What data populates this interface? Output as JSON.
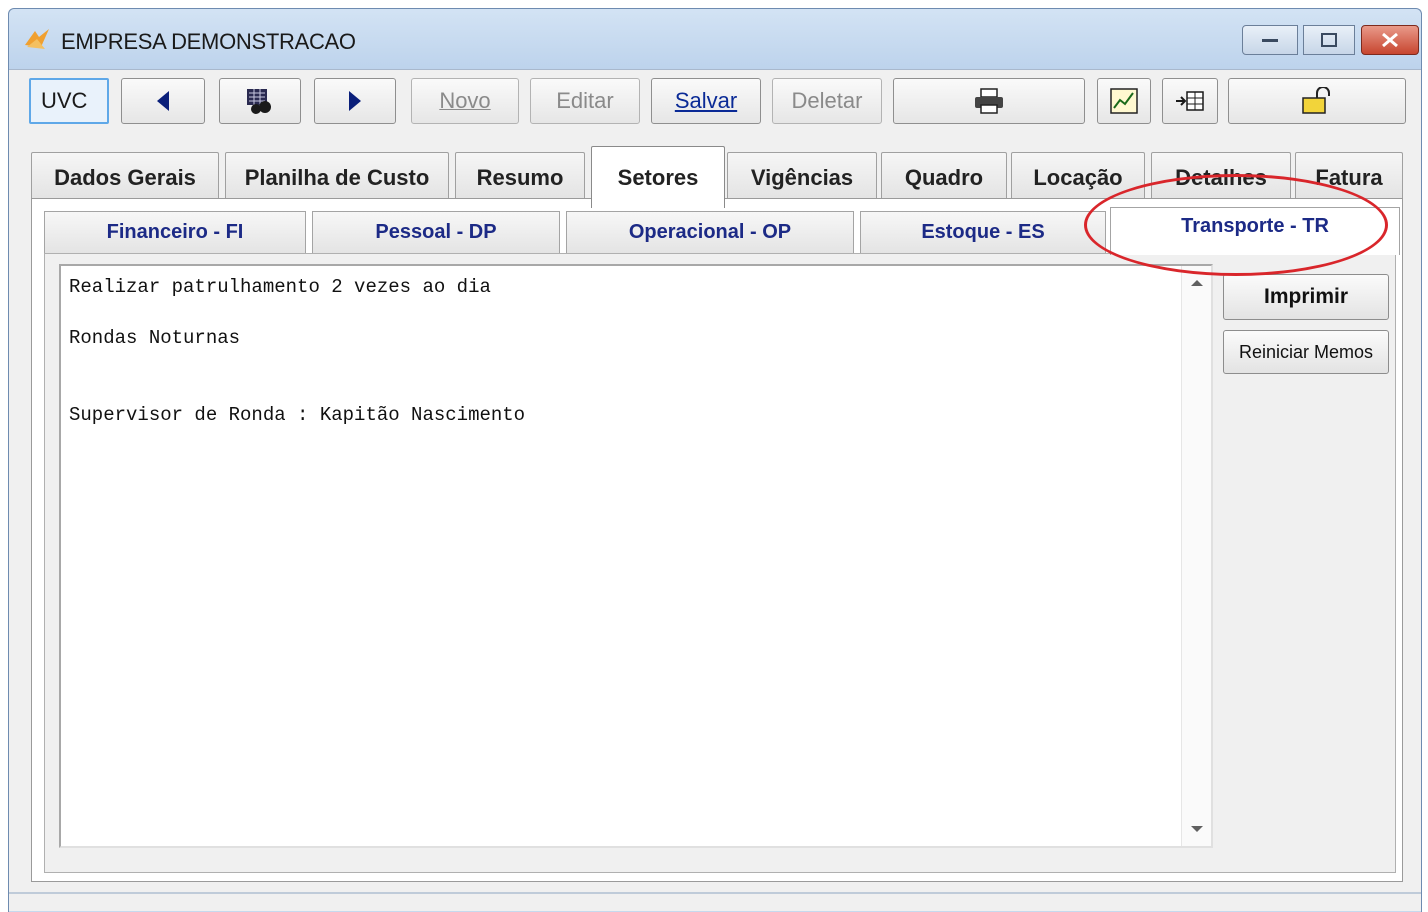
{
  "window": {
    "title": "EMPRESA DEMONSTRACAO"
  },
  "toolbar": {
    "uvc_label": "UVC",
    "novo_label": "Novo",
    "editar_label": "Editar",
    "salvar_label": "Salvar",
    "deletar_label": "Deletar"
  },
  "main_tabs": [
    {
      "label": "Dados Gerais"
    },
    {
      "label": "Planilha de Custo"
    },
    {
      "label": "Resumo"
    },
    {
      "label": "Setores",
      "selected": true
    },
    {
      "label": "Vigências"
    },
    {
      "label": "Quadro"
    },
    {
      "label": "Locação"
    },
    {
      "label": "Detalhes"
    },
    {
      "label": "Fatura"
    }
  ],
  "sub_tabs": [
    {
      "label": "Financeiro - FI"
    },
    {
      "label": "Pessoal - DP"
    },
    {
      "label": "Operacional - OP"
    },
    {
      "label": "Estoque - ES"
    },
    {
      "label": "Transporte - TR",
      "selected": true
    }
  ],
  "memo": {
    "lines": [
      "Realizar patrulhamento 2 vezes ao dia",
      "Rondas Noturnas",
      "Supervisor de Ronda : Kapitão Nascimento"
    ]
  },
  "side_buttons": {
    "imprimir": "Imprimir",
    "reiniciar": "Reiniciar Memos"
  },
  "colors": {
    "highlight": "#d9262b",
    "tab_text": "#1c2a86"
  }
}
